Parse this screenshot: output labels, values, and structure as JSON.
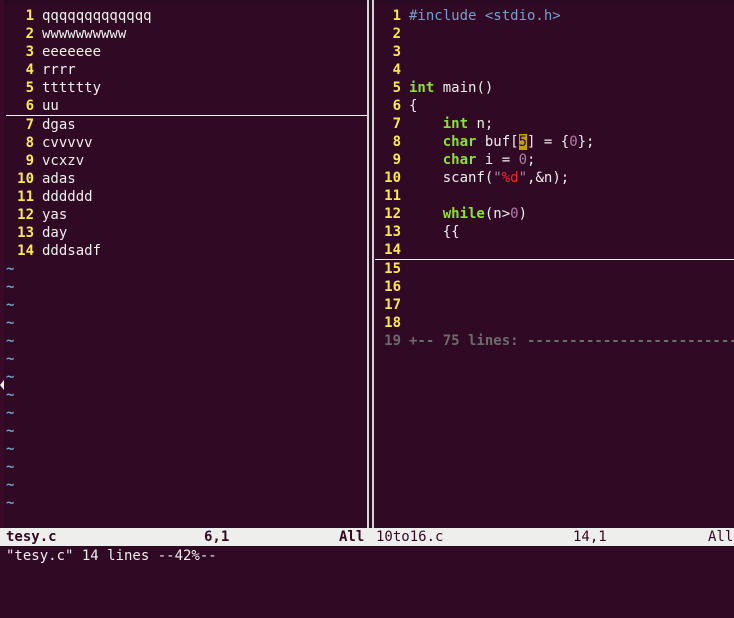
{
  "left": {
    "lines": [
      {
        "n": "1",
        "text": "qqqqqqqqqqqqq"
      },
      {
        "n": "2",
        "text": "wwwwwwwwww"
      },
      {
        "n": "3",
        "text": "eeeeeee"
      },
      {
        "n": "4",
        "text": "rrrr"
      },
      {
        "n": "5",
        "text": "tttttty"
      },
      {
        "n": "6",
        "text": "uu"
      },
      {
        "n": "7",
        "text": "dgas"
      },
      {
        "n": "8",
        "text": "cvvvvv"
      },
      {
        "n": "9",
        "text": "vcxzv"
      },
      {
        "n": "10",
        "text": "adas"
      },
      {
        "n": "11",
        "text": "dddddd"
      },
      {
        "n": "12",
        "text": "yas"
      },
      {
        "n": "13",
        "text": "day"
      },
      {
        "n": "14",
        "text": "dddsadf"
      }
    ],
    "tilde": "~",
    "status": {
      "filename": "tesy.c",
      "position": "6,1",
      "scroll": "All"
    }
  },
  "right": {
    "lines": [
      {
        "n": "1",
        "tokens": [
          {
            "t": "#include <stdio.h>",
            "c": "pre"
          }
        ]
      },
      {
        "n": "2",
        "tokens": []
      },
      {
        "n": "3",
        "tokens": []
      },
      {
        "n": "4",
        "tokens": []
      },
      {
        "n": "5",
        "tokens": [
          {
            "t": "int",
            "c": "type"
          },
          {
            "t": " main()"
          }
        ]
      },
      {
        "n": "6",
        "tokens": [
          {
            "t": "{"
          }
        ]
      },
      {
        "n": "7",
        "tokens": [
          {
            "t": "    "
          },
          {
            "t": "int",
            "c": "type"
          },
          {
            "t": " n;"
          }
        ]
      },
      {
        "n": "8",
        "tokens": [
          {
            "t": "    "
          },
          {
            "t": "char",
            "c": "type"
          },
          {
            "t": " buf["
          },
          {
            "t": "5",
            "c": "cursor"
          },
          {
            "t": "] = {"
          },
          {
            "t": "0",
            "c": "num"
          },
          {
            "t": "};"
          }
        ]
      },
      {
        "n": "9",
        "tokens": [
          {
            "t": "    "
          },
          {
            "t": "char",
            "c": "type"
          },
          {
            "t": " i = "
          },
          {
            "t": "0",
            "c": "num"
          },
          {
            "t": ";"
          }
        ]
      },
      {
        "n": "10",
        "tokens": [
          {
            "t": "    scanf("
          },
          {
            "t": "\"",
            "c": "str"
          },
          {
            "t": "%d",
            "c": "fmt"
          },
          {
            "t": "\"",
            "c": "str"
          },
          {
            "t": ",&n);"
          }
        ]
      },
      {
        "n": "11",
        "tokens": []
      },
      {
        "n": "12",
        "tokens": [
          {
            "t": "    "
          },
          {
            "t": "while",
            "c": "type"
          },
          {
            "t": "(n>"
          },
          {
            "t": "0",
            "c": "num"
          },
          {
            "t": ")"
          }
        ]
      },
      {
        "n": "13",
        "tokens": [
          {
            "t": "    {{"
          }
        ]
      },
      {
        "n": "14",
        "tokens": []
      },
      {
        "n": "15",
        "tokens": []
      },
      {
        "n": "16",
        "tokens": []
      },
      {
        "n": "17",
        "tokens": []
      },
      {
        "n": "18",
        "tokens": []
      },
      {
        "n": "19",
        "tokens": [
          {
            "t": "+-- 75 lines: --------------------------",
            "c": "fold"
          }
        ]
      }
    ],
    "status": {
      "filename": "10to16.c",
      "position": "14,1",
      "scroll": "All"
    }
  },
  "cmdline": "\"tesy.c\" 14 lines --42%--",
  "colors": {
    "background": "#300a24",
    "line_number": "#fce94f",
    "keyword": "#8ae234",
    "preprocessor": "#729fcf",
    "constant": "#ad7fa8",
    "format_specifier": "#ef2929",
    "fold": "#6b6b6b",
    "cursor": "#c4a000"
  }
}
